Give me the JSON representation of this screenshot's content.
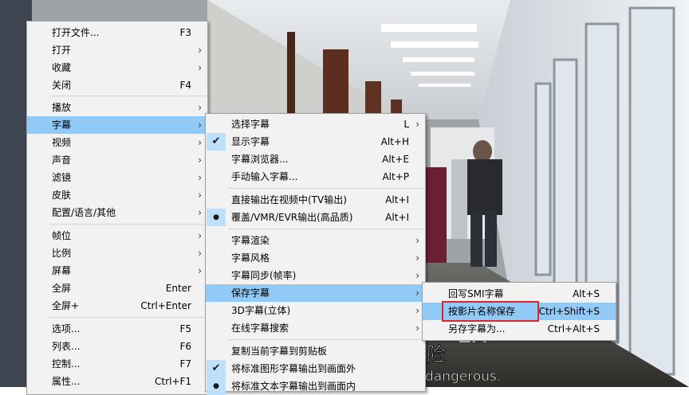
{
  "video": {
    "subtitle_cn_fragment": "险",
    "subtitle_en_fragment": "dangerous.",
    "sign_text": "LR"
  },
  "main_menu": {
    "items": [
      {
        "label": "打开文件...",
        "shortcut": "F3",
        "arrow": false
      },
      {
        "label": "打开",
        "shortcut": "",
        "arrow": true
      },
      {
        "label": "收藏",
        "shortcut": "",
        "arrow": true
      },
      {
        "label": "关闭",
        "shortcut": "F4",
        "arrow": false
      },
      {
        "label": "播放",
        "shortcut": "",
        "arrow": true
      },
      {
        "label": "字幕",
        "shortcut": "",
        "arrow": true,
        "highlighted": true
      },
      {
        "label": "视频",
        "shortcut": "",
        "arrow": true
      },
      {
        "label": "声音",
        "shortcut": "",
        "arrow": true
      },
      {
        "label": "滤镜",
        "shortcut": "",
        "arrow": true
      },
      {
        "label": "皮肤",
        "shortcut": "",
        "arrow": true
      },
      {
        "label": "配置/语言/其他",
        "shortcut": "",
        "arrow": true
      },
      {
        "label": "帧位",
        "shortcut": "",
        "arrow": true
      },
      {
        "label": "比例",
        "shortcut": "",
        "arrow": true
      },
      {
        "label": "屏幕",
        "shortcut": "",
        "arrow": true
      },
      {
        "label": "全屏",
        "shortcut": "Enter",
        "arrow": false
      },
      {
        "label": "全屏+",
        "shortcut": "Ctrl+Enter",
        "arrow": false
      },
      {
        "label": "选项...",
        "shortcut": "F5",
        "arrow": false
      },
      {
        "label": "列表...",
        "shortcut": "F6",
        "arrow": false
      },
      {
        "label": "控制...",
        "shortcut": "F7",
        "arrow": false
      },
      {
        "label": "属性...",
        "shortcut": "Ctrl+F1",
        "arrow": false
      }
    ]
  },
  "subtitle_menu": {
    "items": [
      {
        "label": "选择字幕",
        "shortcut": "L",
        "arrow": true
      },
      {
        "label": "显示字幕",
        "shortcut": "Alt+H",
        "check": "checkmark"
      },
      {
        "label": "字幕浏览器...",
        "shortcut": "Alt+E"
      },
      {
        "label": "手动输入字幕...",
        "shortcut": "Alt+P"
      },
      {
        "label": "直接输出在视频中(TV输出)",
        "shortcut": "Alt+I"
      },
      {
        "label": "覆盖/VMR/EVR输出(高品质)",
        "shortcut": "Alt+I",
        "check": "bullet"
      },
      {
        "label": "字幕渲染",
        "shortcut": "",
        "arrow": true
      },
      {
        "label": "字幕风格",
        "shortcut": "",
        "arrow": true
      },
      {
        "label": "字幕同步(帧率)",
        "shortcut": "",
        "arrow": true
      },
      {
        "label": "保存字幕",
        "shortcut": "",
        "arrow": true,
        "highlighted": true
      },
      {
        "label": "3D字幕(立体)",
        "shortcut": "",
        "arrow": true
      },
      {
        "label": "在线字幕搜索",
        "shortcut": "",
        "arrow": true
      },
      {
        "label": "复制当前字幕到剪贴板",
        "shortcut": ""
      },
      {
        "label": "将标准图形字幕输出到画面外",
        "shortcut": "",
        "check": "checkmark"
      },
      {
        "label": "将标准文本字幕输出到画面内",
        "shortcut": "",
        "check": "bullet"
      }
    ]
  },
  "save_menu": {
    "items": [
      {
        "label": "回写SMI字幕",
        "shortcut": "Alt+S"
      },
      {
        "label": "按影片名称保存",
        "shortcut": "Ctrl+Shift+S",
        "highlighted": true,
        "boxed": true
      },
      {
        "label": "另存字幕为...",
        "shortcut": "Ctrl+Alt+S"
      }
    ]
  },
  "glyphs": {
    "arrow": "›",
    "checkmark": "✔",
    "bullet": "●"
  },
  "colors": {
    "highlight": "#91c9f7",
    "menu_bg": "#f2f2f2",
    "red_box": "#d9252b"
  }
}
